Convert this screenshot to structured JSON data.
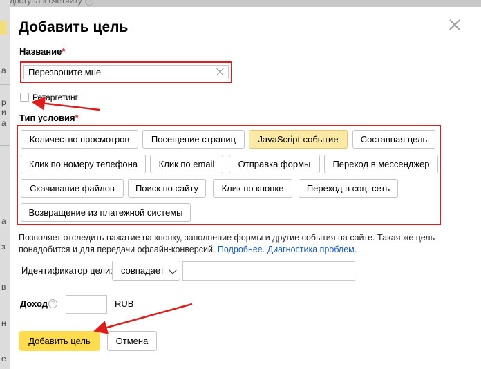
{
  "background": {
    "top_text": "доступа к счетчику",
    "fragments": [
      "а",
      "р",
      "и",
      "а",
      "а",
      "з",
      "в",
      "н",
      "е"
    ]
  },
  "modal": {
    "title": "Добавить цель",
    "name_field": {
      "label": "Название",
      "required_mark": "*",
      "value": "Перезвоните мне"
    },
    "retargeting": {
      "label": "Ретаргетинг",
      "checked": false
    },
    "condition_type": {
      "label": "Тип условия",
      "required_mark": "*",
      "options": [
        {
          "label": "Количество просмотров",
          "active": false
        },
        {
          "label": "Посещение страниц",
          "active": false
        },
        {
          "label": "JavaScript-событие",
          "active": true
        },
        {
          "label": "Составная цель",
          "active": false
        },
        {
          "label": "Клик по номеру телефона",
          "active": false
        },
        {
          "label": "Клик по email",
          "active": false
        },
        {
          "label": "Отправка формы",
          "active": false
        },
        {
          "label": "Переход в мессенджер",
          "active": false
        },
        {
          "label": "Скачивание файлов",
          "active": false
        },
        {
          "label": "Поиск по сайту",
          "active": false
        },
        {
          "label": "Клик по кнопке",
          "active": false
        },
        {
          "label": "Переход в соц. сеть",
          "active": false
        },
        {
          "label": "Возвращение из платежной системы",
          "active": false
        }
      ]
    },
    "description": {
      "text": "Позволяет отследить нажатие на кнопку, заполнение формы и другие события на сайте. Такая же цель понадобится и для передачи офлайн-конверсий.",
      "link_more": "Подробнее.",
      "link_diagnostics": "Диагностика проблем."
    },
    "goal_id": {
      "label": "Идентификатор цели:",
      "match_value": "совпадает",
      "value": ""
    },
    "income": {
      "label": "Доход",
      "help_icon": "?",
      "value": "",
      "currency": "RUB"
    },
    "buttons": {
      "submit": "Добавить цель",
      "cancel": "Отмена"
    }
  },
  "colors": {
    "accent_yellow": "#ffdb4d",
    "active_chip": "#fde9a6",
    "highlight_red": "#e01d1d",
    "link_blue": "#1a5cbd"
  }
}
